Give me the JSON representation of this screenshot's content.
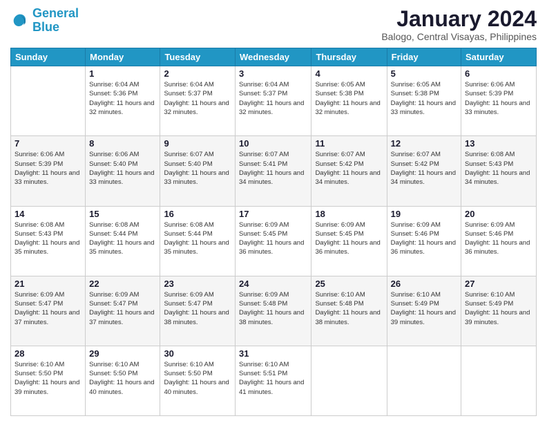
{
  "logo": {
    "line1": "General",
    "line2": "Blue"
  },
  "title": "January 2024",
  "location": "Balogo, Central Visayas, Philippines",
  "weekdays": [
    "Sunday",
    "Monday",
    "Tuesday",
    "Wednesday",
    "Thursday",
    "Friday",
    "Saturday"
  ],
  "weeks": [
    [
      {
        "day": "",
        "sunrise": "",
        "sunset": "",
        "daylight": ""
      },
      {
        "day": "1",
        "sunrise": "Sunrise: 6:04 AM",
        "sunset": "Sunset: 5:36 PM",
        "daylight": "Daylight: 11 hours and 32 minutes."
      },
      {
        "day": "2",
        "sunrise": "Sunrise: 6:04 AM",
        "sunset": "Sunset: 5:37 PM",
        "daylight": "Daylight: 11 hours and 32 minutes."
      },
      {
        "day": "3",
        "sunrise": "Sunrise: 6:04 AM",
        "sunset": "Sunset: 5:37 PM",
        "daylight": "Daylight: 11 hours and 32 minutes."
      },
      {
        "day": "4",
        "sunrise": "Sunrise: 6:05 AM",
        "sunset": "Sunset: 5:38 PM",
        "daylight": "Daylight: 11 hours and 32 minutes."
      },
      {
        "day": "5",
        "sunrise": "Sunrise: 6:05 AM",
        "sunset": "Sunset: 5:38 PM",
        "daylight": "Daylight: 11 hours and 33 minutes."
      },
      {
        "day": "6",
        "sunrise": "Sunrise: 6:06 AM",
        "sunset": "Sunset: 5:39 PM",
        "daylight": "Daylight: 11 hours and 33 minutes."
      }
    ],
    [
      {
        "day": "7",
        "sunrise": "Sunrise: 6:06 AM",
        "sunset": "Sunset: 5:39 PM",
        "daylight": "Daylight: 11 hours and 33 minutes."
      },
      {
        "day": "8",
        "sunrise": "Sunrise: 6:06 AM",
        "sunset": "Sunset: 5:40 PM",
        "daylight": "Daylight: 11 hours and 33 minutes."
      },
      {
        "day": "9",
        "sunrise": "Sunrise: 6:07 AM",
        "sunset": "Sunset: 5:40 PM",
        "daylight": "Daylight: 11 hours and 33 minutes."
      },
      {
        "day": "10",
        "sunrise": "Sunrise: 6:07 AM",
        "sunset": "Sunset: 5:41 PM",
        "daylight": "Daylight: 11 hours and 34 minutes."
      },
      {
        "day": "11",
        "sunrise": "Sunrise: 6:07 AM",
        "sunset": "Sunset: 5:42 PM",
        "daylight": "Daylight: 11 hours and 34 minutes."
      },
      {
        "day": "12",
        "sunrise": "Sunrise: 6:07 AM",
        "sunset": "Sunset: 5:42 PM",
        "daylight": "Daylight: 11 hours and 34 minutes."
      },
      {
        "day": "13",
        "sunrise": "Sunrise: 6:08 AM",
        "sunset": "Sunset: 5:43 PM",
        "daylight": "Daylight: 11 hours and 34 minutes."
      }
    ],
    [
      {
        "day": "14",
        "sunrise": "Sunrise: 6:08 AM",
        "sunset": "Sunset: 5:43 PM",
        "daylight": "Daylight: 11 hours and 35 minutes."
      },
      {
        "day": "15",
        "sunrise": "Sunrise: 6:08 AM",
        "sunset": "Sunset: 5:44 PM",
        "daylight": "Daylight: 11 hours and 35 minutes."
      },
      {
        "day": "16",
        "sunrise": "Sunrise: 6:08 AM",
        "sunset": "Sunset: 5:44 PM",
        "daylight": "Daylight: 11 hours and 35 minutes."
      },
      {
        "day": "17",
        "sunrise": "Sunrise: 6:09 AM",
        "sunset": "Sunset: 5:45 PM",
        "daylight": "Daylight: 11 hours and 36 minutes."
      },
      {
        "day": "18",
        "sunrise": "Sunrise: 6:09 AM",
        "sunset": "Sunset: 5:45 PM",
        "daylight": "Daylight: 11 hours and 36 minutes."
      },
      {
        "day": "19",
        "sunrise": "Sunrise: 6:09 AM",
        "sunset": "Sunset: 5:46 PM",
        "daylight": "Daylight: 11 hours and 36 minutes."
      },
      {
        "day": "20",
        "sunrise": "Sunrise: 6:09 AM",
        "sunset": "Sunset: 5:46 PM",
        "daylight": "Daylight: 11 hours and 36 minutes."
      }
    ],
    [
      {
        "day": "21",
        "sunrise": "Sunrise: 6:09 AM",
        "sunset": "Sunset: 5:47 PM",
        "daylight": "Daylight: 11 hours and 37 minutes."
      },
      {
        "day": "22",
        "sunrise": "Sunrise: 6:09 AM",
        "sunset": "Sunset: 5:47 PM",
        "daylight": "Daylight: 11 hours and 37 minutes."
      },
      {
        "day": "23",
        "sunrise": "Sunrise: 6:09 AM",
        "sunset": "Sunset: 5:47 PM",
        "daylight": "Daylight: 11 hours and 38 minutes."
      },
      {
        "day": "24",
        "sunrise": "Sunrise: 6:09 AM",
        "sunset": "Sunset: 5:48 PM",
        "daylight": "Daylight: 11 hours and 38 minutes."
      },
      {
        "day": "25",
        "sunrise": "Sunrise: 6:10 AM",
        "sunset": "Sunset: 5:48 PM",
        "daylight": "Daylight: 11 hours and 38 minutes."
      },
      {
        "day": "26",
        "sunrise": "Sunrise: 6:10 AM",
        "sunset": "Sunset: 5:49 PM",
        "daylight": "Daylight: 11 hours and 39 minutes."
      },
      {
        "day": "27",
        "sunrise": "Sunrise: 6:10 AM",
        "sunset": "Sunset: 5:49 PM",
        "daylight": "Daylight: 11 hours and 39 minutes."
      }
    ],
    [
      {
        "day": "28",
        "sunrise": "Sunrise: 6:10 AM",
        "sunset": "Sunset: 5:50 PM",
        "daylight": "Daylight: 11 hours and 39 minutes."
      },
      {
        "day": "29",
        "sunrise": "Sunrise: 6:10 AM",
        "sunset": "Sunset: 5:50 PM",
        "daylight": "Daylight: 11 hours and 40 minutes."
      },
      {
        "day": "30",
        "sunrise": "Sunrise: 6:10 AM",
        "sunset": "Sunset: 5:50 PM",
        "daylight": "Daylight: 11 hours and 40 minutes."
      },
      {
        "day": "31",
        "sunrise": "Sunrise: 6:10 AM",
        "sunset": "Sunset: 5:51 PM",
        "daylight": "Daylight: 11 hours and 41 minutes."
      },
      {
        "day": "",
        "sunrise": "",
        "sunset": "",
        "daylight": ""
      },
      {
        "day": "",
        "sunrise": "",
        "sunset": "",
        "daylight": ""
      },
      {
        "day": "",
        "sunrise": "",
        "sunset": "",
        "daylight": ""
      }
    ]
  ]
}
